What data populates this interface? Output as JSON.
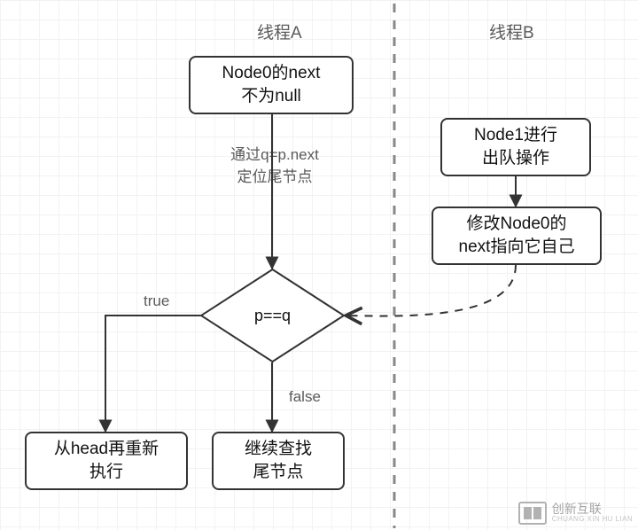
{
  "headers": {
    "threadA": "线程A",
    "threadB": "线程B"
  },
  "nodes": {
    "startA": "Node0的next\n不为null",
    "startB": "Node1进行\n出队操作",
    "modifyB": "修改Node0的\nnext指向它自己",
    "decision": "p==q",
    "leftEnd": "从head再重新\n执行",
    "rightEnd": "继续查找\n尾节点"
  },
  "labels": {
    "viaQ": "通过q=p.next\n定位尾节点",
    "trueLabel": "true",
    "falseLabel": "false"
  },
  "watermark": {
    "brand": "创新互联",
    "sub": "CHUANG XIN HU LIAN"
  },
  "chart_data": {
    "type": "flowchart",
    "title": "",
    "lanes": [
      {
        "id": "A",
        "label": "线程A"
      },
      {
        "id": "B",
        "label": "线程B"
      }
    ],
    "nodes": [
      {
        "id": "n_startA",
        "lane": "A",
        "shape": "process",
        "text": "Node0的next 不为null"
      },
      {
        "id": "n_dec",
        "lane": "A",
        "shape": "decision",
        "text": "p==q"
      },
      {
        "id": "n_left",
        "lane": "A",
        "shape": "process",
        "text": "从head再重新 执行"
      },
      {
        "id": "n_right",
        "lane": "A",
        "shape": "process",
        "text": "继续查找 尾节点"
      },
      {
        "id": "n_startB",
        "lane": "B",
        "shape": "process",
        "text": "Node1进行 出队操作"
      },
      {
        "id": "n_modB",
        "lane": "B",
        "shape": "process",
        "text": "修改Node0的 next指向它自己"
      }
    ],
    "edges": [
      {
        "from": "n_startA",
        "to": "n_dec",
        "label": "通过q=p.next 定位尾节点",
        "style": "solid"
      },
      {
        "from": "n_dec",
        "to": "n_left",
        "label": "true",
        "style": "solid"
      },
      {
        "from": "n_dec",
        "to": "n_right",
        "label": "false",
        "style": "solid"
      },
      {
        "from": "n_startB",
        "to": "n_modB",
        "label": "",
        "style": "solid"
      },
      {
        "from": "n_modB",
        "to": "n_dec",
        "label": "",
        "style": "dashed"
      }
    ]
  }
}
